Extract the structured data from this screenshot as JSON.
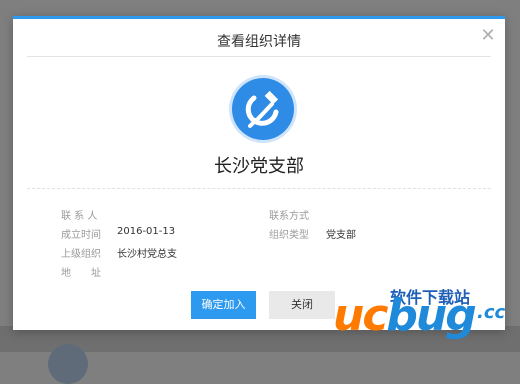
{
  "dialog": {
    "title": "查看组织详情",
    "close_icon": "close-icon",
    "accent_color": "#2e9aef"
  },
  "org": {
    "emblem_icon": "hammer-sickle-emblem-icon",
    "name": "长沙党支部"
  },
  "info": {
    "contact_person_label": "联 系 人",
    "contact_method_label": "联系方式",
    "founded_label": "成立时间",
    "founded_value": "2016-01-13",
    "org_type_label": "组织类型",
    "org_type_value": "党支部",
    "parent_org_label": "上级组织",
    "parent_org_value": "长沙村党总支",
    "address_label": "地　　址"
  },
  "buttons": {
    "join_label": "确定加入",
    "close_label": "关闭"
  },
  "watermark": {
    "cn_text": "软件下载站",
    "logo_left": "uc",
    "logo_right": "bug",
    "suffix": ".cc"
  }
}
